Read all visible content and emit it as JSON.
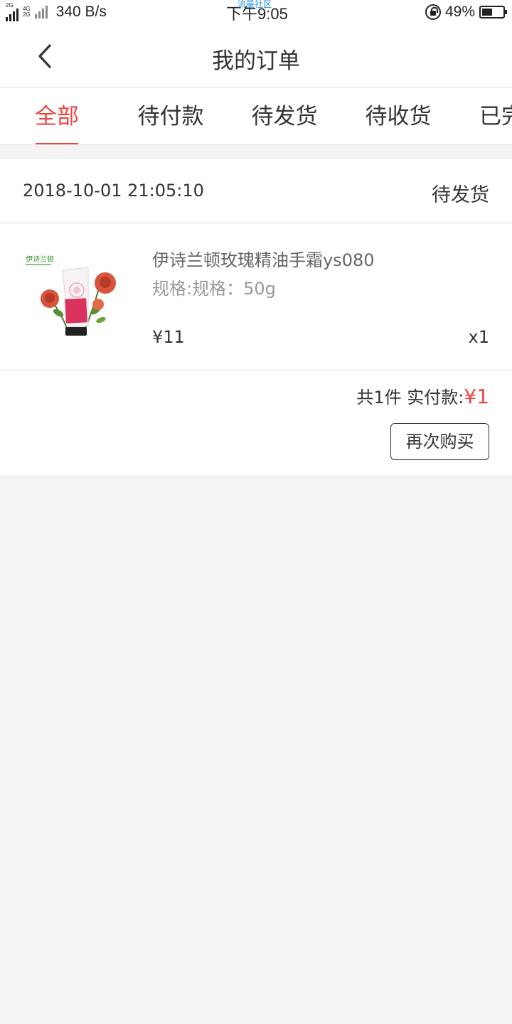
{
  "status_bar": {
    "signal_label_1": "2G",
    "signal_label_2a": "4G",
    "signal_label_2b": "2G",
    "net_speed": "340 B/s",
    "carrier_text": "流量社区",
    "time": "下午9:05",
    "battery_percent": "49%",
    "battery_level": 0.49
  },
  "navbar": {
    "title": "我的订单",
    "back_icon": "chevron-left-icon"
  },
  "tabs": [
    {
      "label": "全部",
      "active": true
    },
    {
      "label": "待付款",
      "active": false
    },
    {
      "label": "待发货",
      "active": false
    },
    {
      "label": "待收货",
      "active": false
    },
    {
      "label": "已完成",
      "active": false
    }
  ],
  "order": {
    "date": "2018-10-01 21:05:10",
    "status": "待发货",
    "product": {
      "name": "伊诗兰顿玫瑰精油手霜ys080",
      "spec": "规格:规格：50g",
      "price": "¥11",
      "quantity": "x1",
      "brand_logo_text": "伊诗兰顿"
    },
    "summary_prefix": "共1件 实付款:",
    "total_amount": "¥1",
    "rebuy_label": "再次购买"
  },
  "colors": {
    "accent": "#f0433f",
    "background": "#f4f4f4",
    "text": "#333333"
  }
}
